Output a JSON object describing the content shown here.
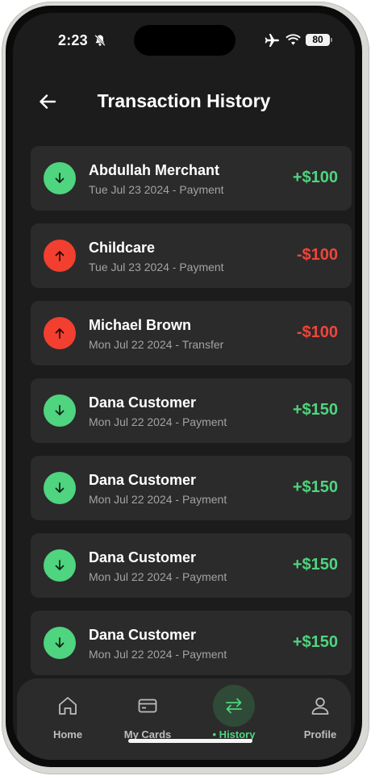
{
  "status_bar": {
    "time": "2:23",
    "battery": "80"
  },
  "header": {
    "title": "Transaction History"
  },
  "transactions": [
    {
      "name": "Abdullah Merchant",
      "subtitle": "Tue Jul 23 2024 - Payment",
      "amount": "+$100",
      "direction": "in"
    },
    {
      "name": "Childcare",
      "subtitle": "Tue Jul 23 2024 - Payment",
      "amount": "-$100",
      "direction": "out"
    },
    {
      "name": "Michael Brown",
      "subtitle": "Mon Jul 22 2024 - Transfer",
      "amount": "-$100",
      "direction": "out"
    },
    {
      "name": "Dana Customer",
      "subtitle": "Mon Jul 22 2024 - Payment",
      "amount": "+$150",
      "direction": "in"
    },
    {
      "name": "Dana Customer",
      "subtitle": "Mon Jul 22 2024 - Payment",
      "amount": "+$150",
      "direction": "in"
    },
    {
      "name": "Dana Customer",
      "subtitle": "Mon Jul 22 2024 - Payment",
      "amount": "+$150",
      "direction": "in"
    },
    {
      "name": "Dana Customer",
      "subtitle": "Mon Jul 22 2024 - Payment",
      "amount": "+$150",
      "direction": "in"
    }
  ],
  "tabs": [
    {
      "label": "Home",
      "icon": "home-icon",
      "active": false
    },
    {
      "label": "My Cards",
      "icon": "card-icon",
      "active": false
    },
    {
      "label": "• History",
      "icon": "swap-arrows-icon",
      "active": true
    },
    {
      "label": "Profile",
      "icon": "user-icon",
      "active": false
    }
  ],
  "colors": {
    "background": "#1c1c1c",
    "card": "#2b2b2b",
    "positive": "#4fd47f",
    "negative": "#f0453a",
    "active_tab_bg": "#2f4a37"
  }
}
